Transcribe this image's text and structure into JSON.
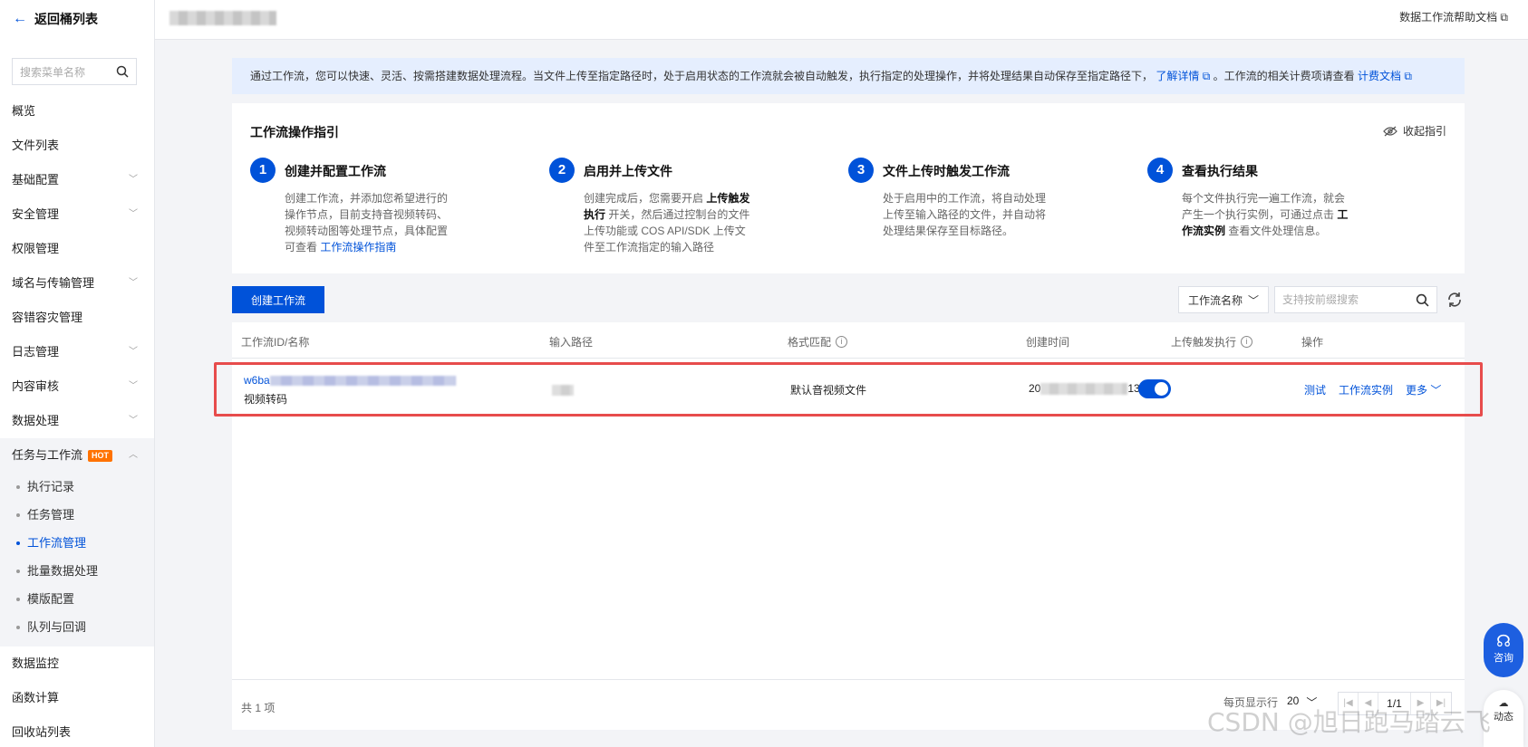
{
  "sidebar": {
    "back_label": "返回桶列表",
    "search_placeholder": "搜索菜单名称",
    "items": [
      {
        "label": "概览"
      },
      {
        "label": "文件列表"
      },
      {
        "label": "基础配置"
      },
      {
        "label": "安全管理"
      },
      {
        "label": "权限管理"
      },
      {
        "label": "域名与传输管理"
      },
      {
        "label": "容错容灾管理"
      },
      {
        "label": "日志管理"
      },
      {
        "label": "内容审核"
      },
      {
        "label": "数据处理"
      },
      {
        "label": "任务与工作流",
        "badge": "HOT"
      }
    ],
    "sub_items": [
      {
        "label": "执行记录"
      },
      {
        "label": "任务管理"
      },
      {
        "label": "工作流管理"
      },
      {
        "label": "批量数据处理"
      },
      {
        "label": "模版配置"
      },
      {
        "label": "队列与回调"
      }
    ],
    "bottom_items": [
      {
        "label": "数据监控"
      },
      {
        "label": "函数计算"
      },
      {
        "label": "回收站列表"
      }
    ]
  },
  "topbar": {
    "help_label": "数据工作流帮助文档"
  },
  "notice": {
    "text": "通过工作流，您可以快速、灵活、按需搭建数据处理流程。当文件上传至指定路径时，处于启用状态的工作流就会被自动触发，执行指定的处理操作，并将处理结果自动保存至指定路径下，",
    "link1": "了解详情",
    "text2": "。工作流的相关计费项请查看",
    "link2": "计费文档"
  },
  "guide": {
    "title": "工作流操作指引",
    "collapse_label": "收起指引",
    "steps": [
      {
        "num": "1",
        "title": "创建并配置工作流",
        "desc": "创建工作流，并添加您希望进行的操作节点，目前支持音视频转码、视频转动图等处理节点，具体配置可查看",
        "link": "工作流操作指南"
      },
      {
        "num": "2",
        "title": "启用并上传文件",
        "desc_a": "创建完成后，您需要开启",
        "bold": "上传触发执行",
        "desc_b": "开关，然后通过控制台的文件上传功能或 COS API/SDK 上传文件至工作流指定的输入路径"
      },
      {
        "num": "3",
        "title": "文件上传时触发工作流",
        "desc": "处于启用中的工作流，将自动处理上传至输入路径的文件，并自动将处理结果保存至目标路径。"
      },
      {
        "num": "4",
        "title": "查看执行结果",
        "desc_a": "每个文件执行完一遍工作流，就会产生一个执行实例，可通过点击",
        "bold": "工作流实例",
        "desc_b": "查看文件处理信息。"
      }
    ]
  },
  "toolbar": {
    "create_label": "创建工作流",
    "filter_label": "工作流名称",
    "search_placeholder": "支持按前缀搜索"
  },
  "table": {
    "headers": {
      "id_name": "工作流ID/名称",
      "input_path": "输入路径",
      "format": "格式匹配",
      "created": "创建时间",
      "trigger": "上传触发执行",
      "actions": "操作"
    },
    "rows": [
      {
        "id_prefix": "w6ba",
        "name": "视频转码",
        "format": "默认音视频文件",
        "created_prefix": "20",
        "created_suffix": "13",
        "trigger_on": true,
        "action_test": "测试",
        "action_instances": "工作流实例",
        "action_more": "更多"
      }
    ],
    "total": "共 1 项",
    "per_page_label": "每页显示行",
    "per_page_value": "20",
    "page_indicator": "1/1"
  },
  "widgets": {
    "consult_label": "咨询",
    "news_label": "动态",
    "watermark": "CSDN @旭日跑马踏云飞"
  },
  "colors": {
    "primary": "#0052d9",
    "hot_badge": "#ff7200",
    "highlight_border": "#e74c4c"
  }
}
